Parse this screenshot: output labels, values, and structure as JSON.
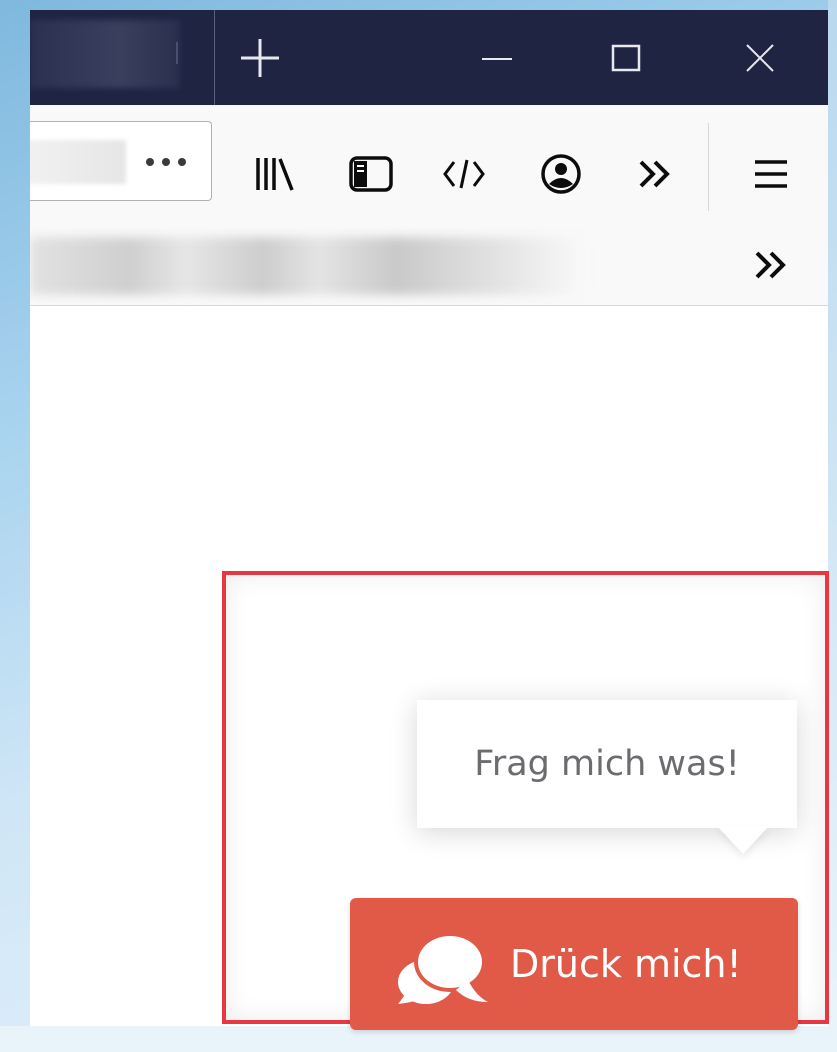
{
  "titlebar": {
    "new_tab_icon": "plus-icon",
    "window_controls": [
      "minimize-icon",
      "maximize-icon",
      "close-icon"
    ]
  },
  "navbar": {
    "page_actions_icon": "ellipsis-icon",
    "tools": [
      "library-icon",
      "sidebar-icon",
      "developer-tools-icon",
      "account-icon",
      "overflow-chevrons-icon",
      "hamburger-menu-icon"
    ]
  },
  "bookmarks": {
    "overflow_icon": "chevrons-icon"
  },
  "widget": {
    "bubble_text": "Frag mich was!",
    "button_label": "Drück mich!",
    "button_icon": "chat-bubbles-icon",
    "accent_color": "#e05a47",
    "highlight_color": "#e8373f"
  }
}
